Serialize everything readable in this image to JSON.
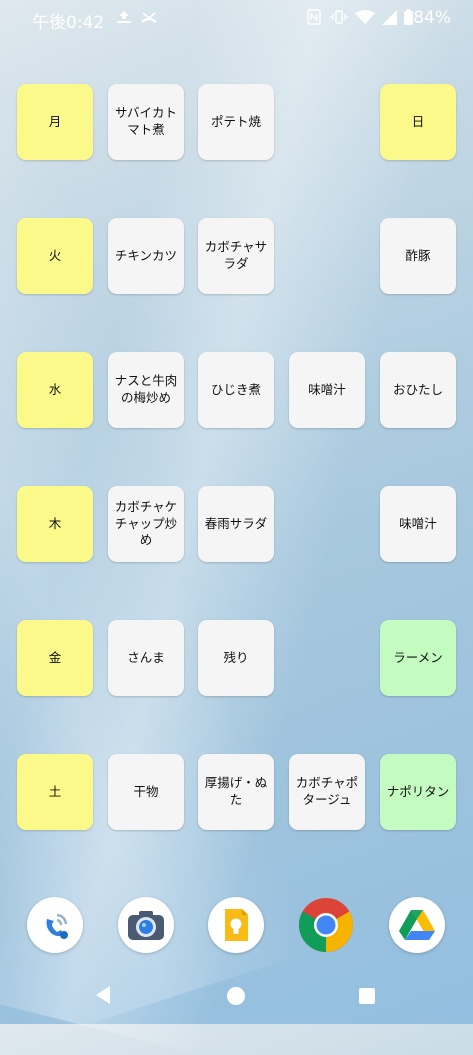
{
  "status_bar": {
    "time": "午後0:42",
    "battery": "84%",
    "icons": [
      "upload-icon",
      "missed-call-icon",
      "nfc-icon",
      "vibrate-icon",
      "wifi-icon",
      "signal-icon",
      "battery-icon"
    ]
  },
  "days": [
    "月",
    "火",
    "水",
    "木",
    "金",
    "土",
    "日"
  ],
  "meals": {
    "mon": [
      "サバイカトマト煮",
      "ポテト焼"
    ],
    "tue": [
      "チキンカツ",
      "カボチャサラダ",
      "酢豚"
    ],
    "wed": [
      "ナスと牛肉の梅炒め",
      "ひじき煮",
      "味噌汁",
      "おひたし"
    ],
    "thu": [
      "カボチャケチャップ炒め",
      "春雨サラダ",
      "味噌汁"
    ],
    "fri": [
      "さんま",
      "残り",
      "ラーメン"
    ],
    "sat": [
      "干物",
      "厚揚げ・ぬた",
      "カボチャポタージュ",
      "ナポリタン"
    ]
  },
  "dock": [
    "phone-app-icon",
    "camera-app-icon",
    "keep-notes-icon",
    "chrome-icon",
    "google-drive-icon"
  ],
  "colors": {
    "day_tile": "#fbf98a",
    "meal_tile": "#f5f5f5",
    "highlight_tile": "#c3fbc0"
  }
}
